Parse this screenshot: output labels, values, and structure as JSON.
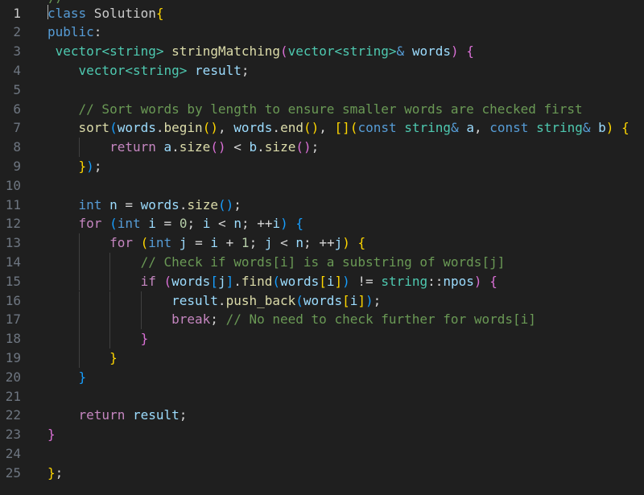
{
  "editor": {
    "language": "cpp",
    "active_line": 1,
    "theme_colors": {
      "background": "#1f1f1f",
      "line_number": "#6e7681",
      "active_line_number": "#cccccc",
      "keyword": "#569cd6",
      "control": "#c586c0",
      "type": "#4ec9b0",
      "function": "#dcdcaa",
      "variable": "#9cdcfe",
      "number": "#b5cea8",
      "comment": "#6a9955",
      "bracket_1": "#ffd700",
      "bracket_2": "#da70d6",
      "bracket_3": "#179fff"
    },
    "lines": [
      {
        "number": "1",
        "text": "class Solution{"
      },
      {
        "number": "2",
        "text": "public:"
      },
      {
        "number": "3",
        "text": " vector<string> stringMatching(vector<string>& words) {"
      },
      {
        "number": "4",
        "text": "    vector<string> result;"
      },
      {
        "number": "5",
        "text": ""
      },
      {
        "number": "6",
        "text": "    // Sort words by length to ensure smaller words are checked first"
      },
      {
        "number": "7",
        "text": "    sort(words.begin(), words.end(), [](const string& a, const string& b) {"
      },
      {
        "number": "8",
        "text": "        return a.size() < b.size();"
      },
      {
        "number": "9",
        "text": "    });"
      },
      {
        "number": "10",
        "text": ""
      },
      {
        "number": "11",
        "text": "    int n = words.size();"
      },
      {
        "number": "12",
        "text": "    for (int i = 0; i < n; ++i) {"
      },
      {
        "number": "13",
        "text": "        for (int j = i + 1; j < n; ++j) {"
      },
      {
        "number": "14",
        "text": "            // Check if words[i] is a substring of words[j]"
      },
      {
        "number": "15",
        "text": "            if (words[j].find(words[i]) != string::npos) {"
      },
      {
        "number": "16",
        "text": "                result.push_back(words[i]);"
      },
      {
        "number": "17",
        "text": "                break; // No need to check further for words[i]"
      },
      {
        "number": "18",
        "text": "            }"
      },
      {
        "number": "19",
        "text": "        }"
      },
      {
        "number": "20",
        "text": "    }"
      },
      {
        "number": "21",
        "text": ""
      },
      {
        "number": "22",
        "text": "    return result;"
      },
      {
        "number": "23",
        "text": "}"
      },
      {
        "number": "24",
        "text": ""
      },
      {
        "number": "25",
        "text": "};"
      }
    ]
  }
}
